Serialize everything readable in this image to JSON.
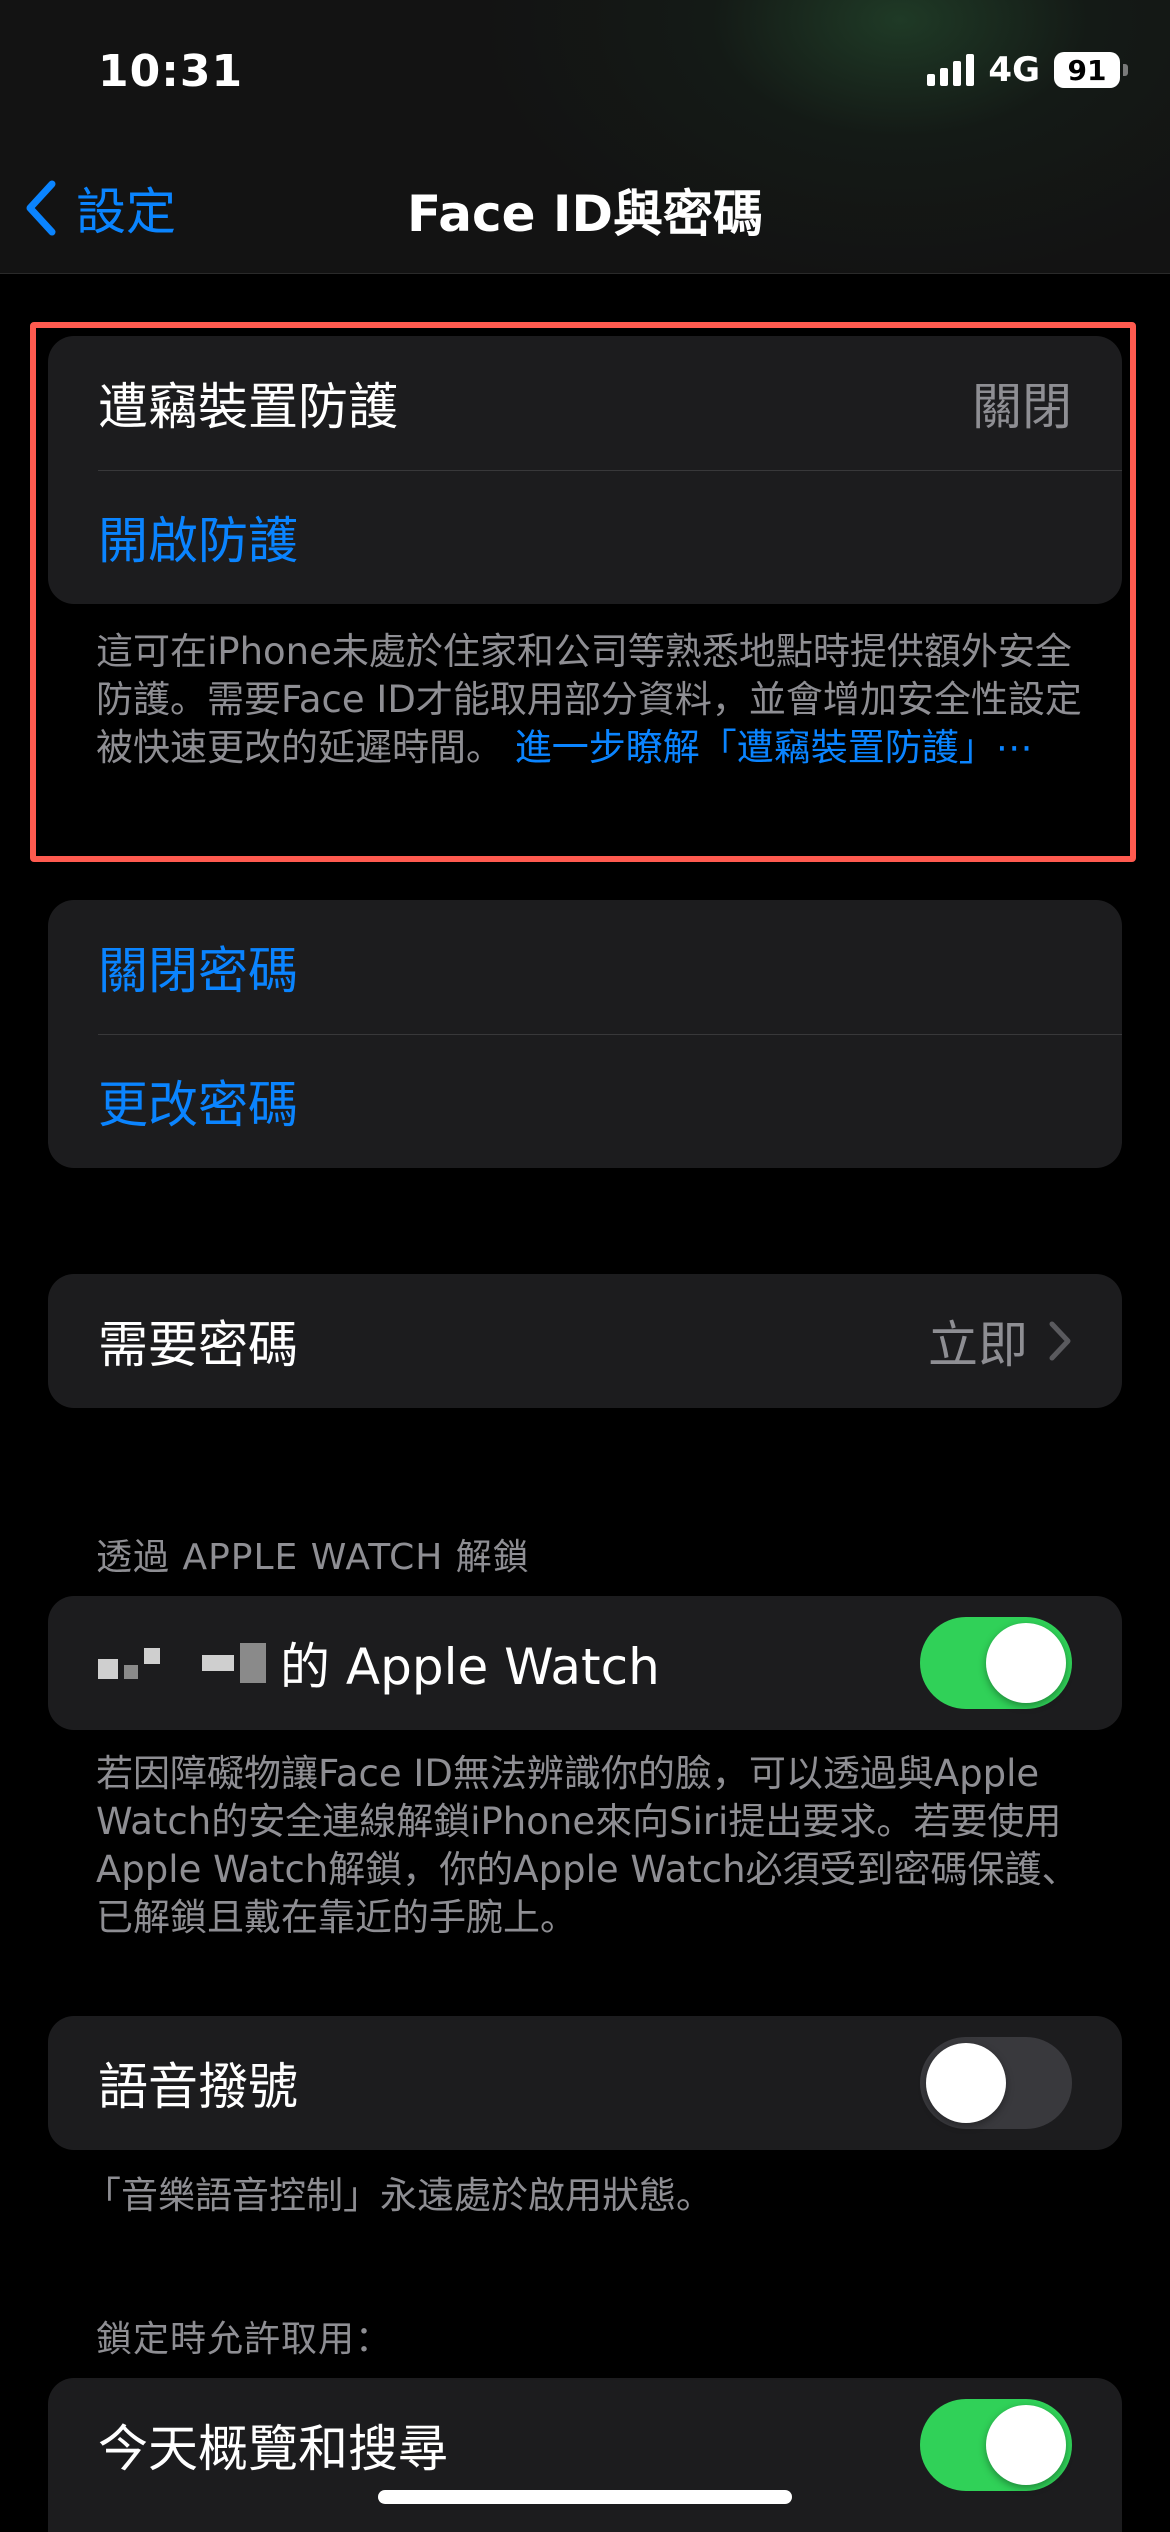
{
  "status_bar": {
    "time": "10:31",
    "network": "4G",
    "battery": "91"
  },
  "nav": {
    "back_label": "設定",
    "title": "Face ID與密碼"
  },
  "stolen_device": {
    "label": "遭竊裝置防護",
    "value": "關閉",
    "action": "開啟防護",
    "footer": "這可在iPhone未處於住家和公司等熟悉地點時提供額外安全防護。需要Face ID才能取用部分資料，並會增加安全性設定被快速更改的延遲時間。",
    "footer_link": "進一步瞭解「遭竊裝置防護」⋯"
  },
  "passcode": {
    "turn_off": "關閉密碼",
    "change": "更改密碼"
  },
  "require_passcode": {
    "label": "需要密碼",
    "value": "立即"
  },
  "apple_watch": {
    "header": "透過 APPLE WATCH 解鎖",
    "label": "的 Apple Watch",
    "enabled": true,
    "footer": "若因障礙物讓Face ID無法辨識你的臉，可以透過與Apple Watch的安全連線解鎖iPhone來向Siri提出要求。若要使用Apple Watch解鎖，你的Apple Watch必須受到密碼保護、已解鎖且戴在靠近的手腕上。"
  },
  "voice_dial": {
    "label": "語音撥號",
    "enabled": false,
    "footer": "「音樂語音控制」永遠處於啟用狀態。"
  },
  "locked_access": {
    "header": "鎖定時允許取用：",
    "today_view": "今天概覽和搜尋",
    "today_view_enabled": true
  },
  "colors": {
    "accent": "#0a84ff",
    "toggle_on": "#30d158",
    "highlight": "#ff5a4f"
  }
}
